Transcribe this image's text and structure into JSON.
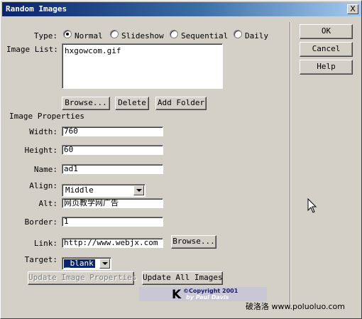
{
  "window": {
    "title": "Random Images",
    "close": "X"
  },
  "type_group": {
    "label": "Type:",
    "options": [
      {
        "label": "Normal",
        "checked": true
      },
      {
        "label": "Slideshow",
        "checked": false
      },
      {
        "label": "Sequential",
        "checked": false
      },
      {
        "label": "Daily",
        "checked": false
      }
    ]
  },
  "image_list": {
    "label": "Image List:",
    "items": [
      "hxgowcom.gif"
    ]
  },
  "list_buttons": {
    "browse": "Browse...",
    "delete": "Delete",
    "add_folder": "Add Folder"
  },
  "properties": {
    "heading": "Image Properties",
    "width": {
      "label": "Width:",
      "value": "760"
    },
    "height": {
      "label": "Height:",
      "value": "60"
    },
    "name": {
      "label": "Name:",
      "value": "ad1"
    },
    "align": {
      "label": "Align:",
      "value": "Middle"
    },
    "alt": {
      "label": "Alt:",
      "value": "网页教学网广告"
    },
    "border": {
      "label": "Border:",
      "value": "1"
    },
    "link": {
      "label": "Link:",
      "value": "http://www.webjx.com",
      "browse": "Browse..."
    },
    "target": {
      "label": "Target:",
      "value": "_blank"
    }
  },
  "bottom_buttons": {
    "update_props": "Update Image Properties",
    "update_all": "Update All Images"
  },
  "side_buttons": {
    "ok": "OK",
    "cancel": "Cancel",
    "help": "Help"
  },
  "copyright": {
    "logo": "K",
    "line1": "©Copyright 2001",
    "line2": "by Paul Davis"
  },
  "watermark": "破洛洛  www.poluoluo.com"
}
